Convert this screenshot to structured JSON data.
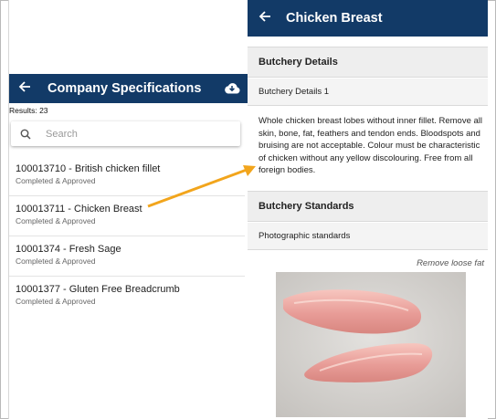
{
  "left": {
    "title": "Company Specifications",
    "results_label": "Results: 23",
    "search_placeholder": "Search",
    "items": [
      {
        "name": "100013710 - British chicken fillet",
        "status": "Completed & Approved"
      },
      {
        "name": "100013711 - Chicken Breast",
        "status": "Completed & Approved"
      },
      {
        "name": "10001374 - Fresh Sage",
        "status": "Completed & Approved"
      },
      {
        "name": "10001377 - Gluten Free Breadcrumb",
        "status": "Completed & Approved"
      }
    ]
  },
  "right": {
    "title": "Chicken Breast",
    "butchery_details_heading": "Butchery Details",
    "butchery_details_sub": "Butchery Details 1",
    "description": "Whole chicken breast lobes without inner fillet. Remove all skin, bone, fat, feathers and tendon ends. Bloodspots and bruising are not acceptable. Colour must be characteristic of chicken without any yellow discolouring. Free from all foreign bodies.",
    "butchery_standards_heading": "Butchery Standards",
    "photographic_standards": "Photographic standards",
    "photo_caption": "Remove loose fat"
  },
  "colors": {
    "appbar": "#123a67",
    "arrow": "#f2a51c"
  },
  "icons": [
    "back-arrow-icon",
    "cloud-download-icon",
    "search-icon"
  ]
}
